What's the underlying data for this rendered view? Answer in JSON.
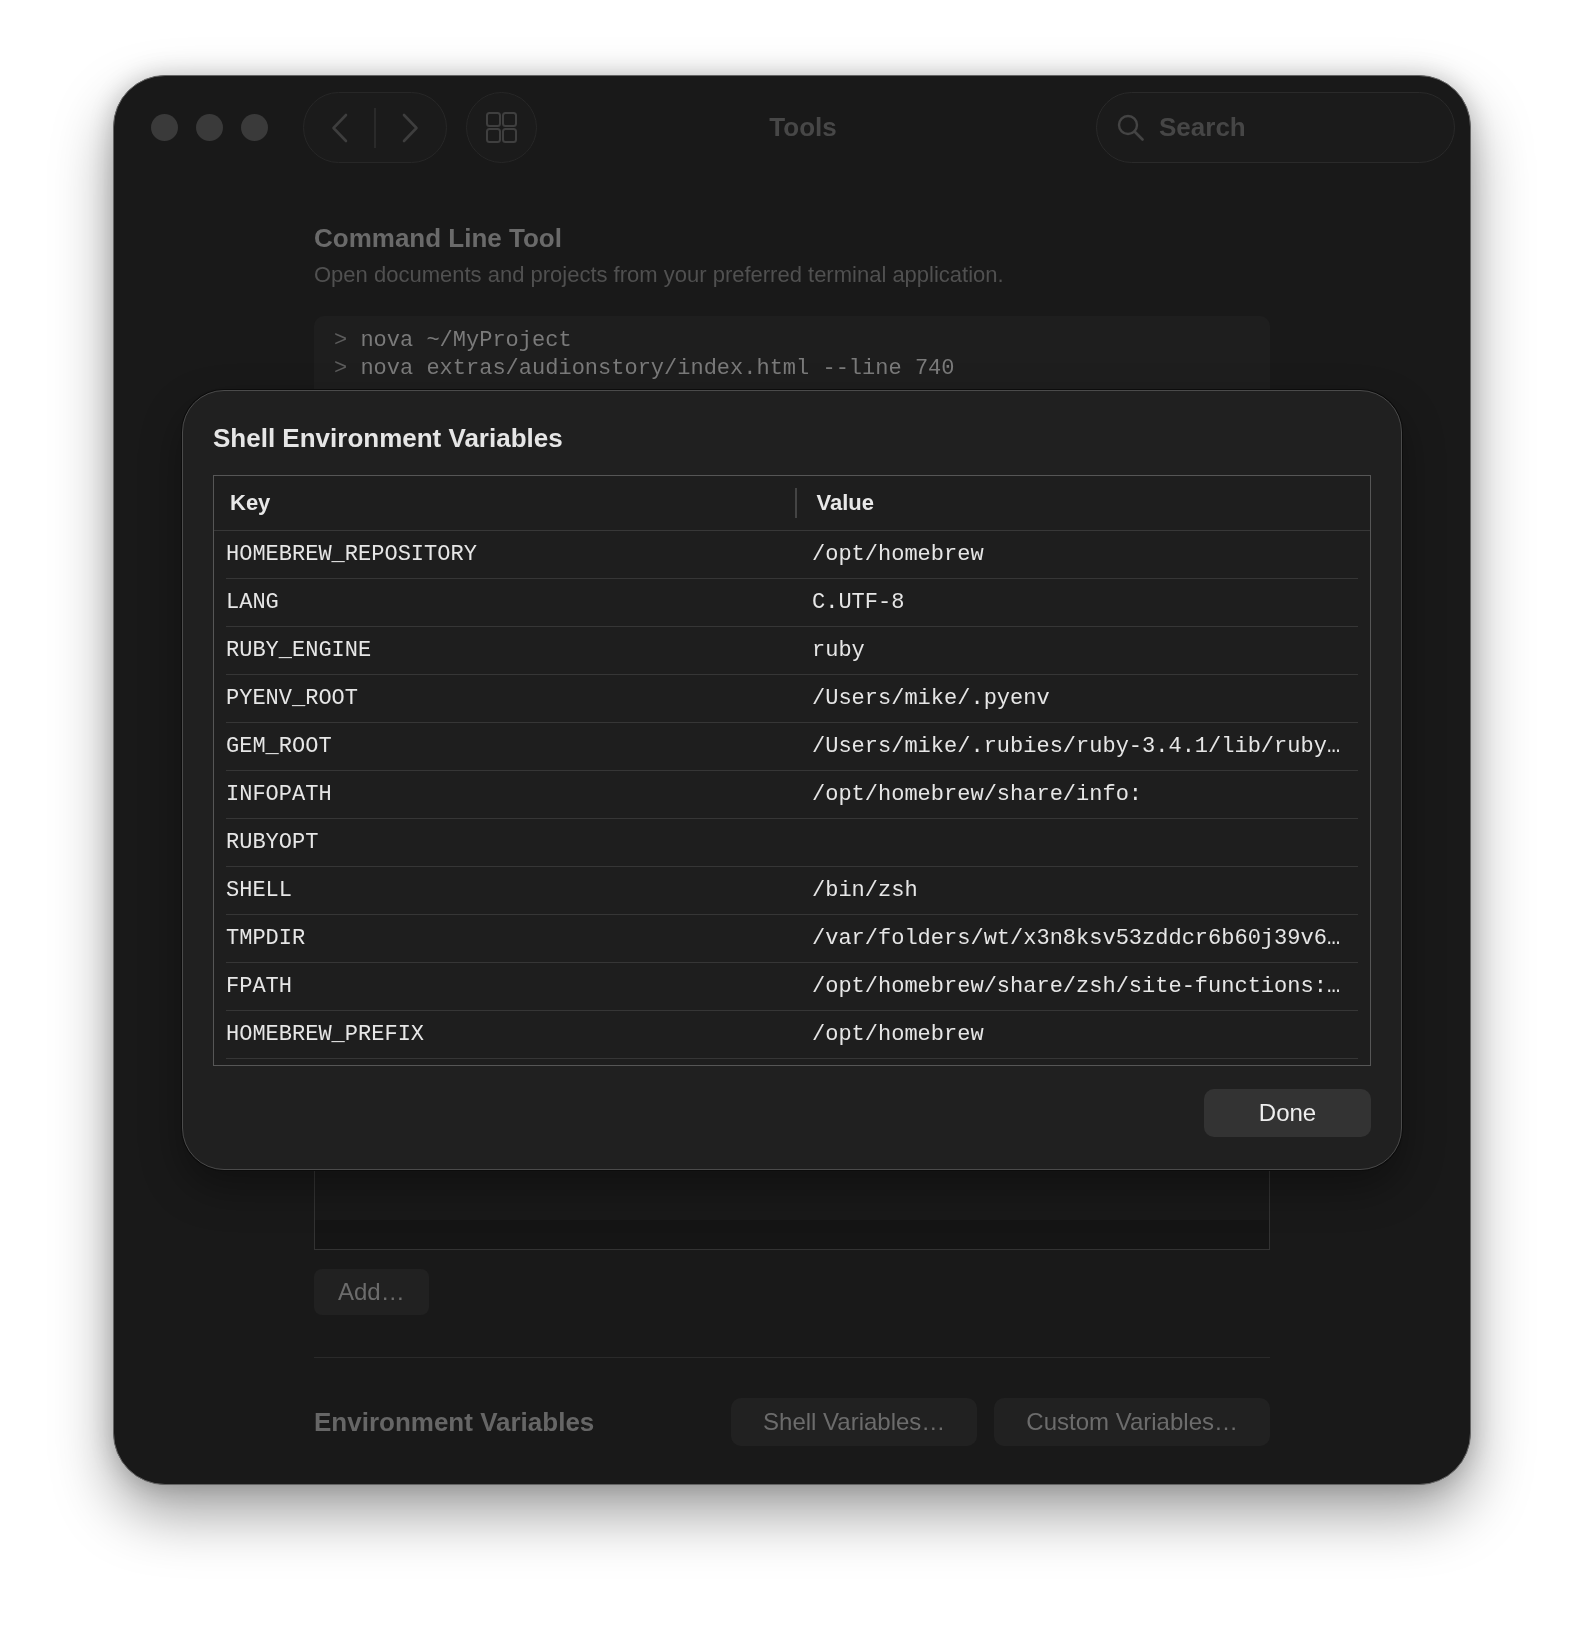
{
  "window": {
    "title": "Tools",
    "search": {
      "placeholder": "Search"
    }
  },
  "command_line_tool": {
    "heading": "Command Line Tool",
    "description": "Open documents and projects from your preferred terminal application.",
    "code_lines": [
      {
        "prompt": ">",
        "command": "nova ~/MyProject"
      },
      {
        "prompt": ">",
        "command": "nova extras/audionstory/index.html --line 740"
      }
    ]
  },
  "dialog": {
    "title": "Shell Environment Variables",
    "columns": [
      "Key",
      "Value"
    ],
    "rows": [
      {
        "key": "HOMEBREW_REPOSITORY",
        "value": "/opt/homebrew"
      },
      {
        "key": "LANG",
        "value": "C.UTF-8"
      },
      {
        "key": "RUBY_ENGINE",
        "value": "ruby"
      },
      {
        "key": "PYENV_ROOT",
        "value": "/Users/mike/.pyenv"
      },
      {
        "key": "GEM_ROOT",
        "value": "/Users/mike/.rubies/ruby-3.4.1/lib/ruby…"
      },
      {
        "key": "INFOPATH",
        "value": "/opt/homebrew/share/info:"
      },
      {
        "key": "RUBYOPT"
      },
      {
        "key": "SHELL",
        "value": "/bin/zsh"
      },
      {
        "key": "TMPDIR",
        "value": "/var/folders/wt/x3n8ksv53zddcr6b60j39v6…"
      },
      {
        "key": "FPATH",
        "value": "/opt/homebrew/share/zsh/site-functions:…"
      },
      {
        "key": "HOMEBREW_PREFIX",
        "value": "/opt/homebrew"
      }
    ],
    "done_button": "Done"
  },
  "add_button": "Add…",
  "environment_variables": {
    "label": "Environment Variables",
    "buttons": [
      "Shell Variables…",
      "Custom Variables…"
    ]
  }
}
